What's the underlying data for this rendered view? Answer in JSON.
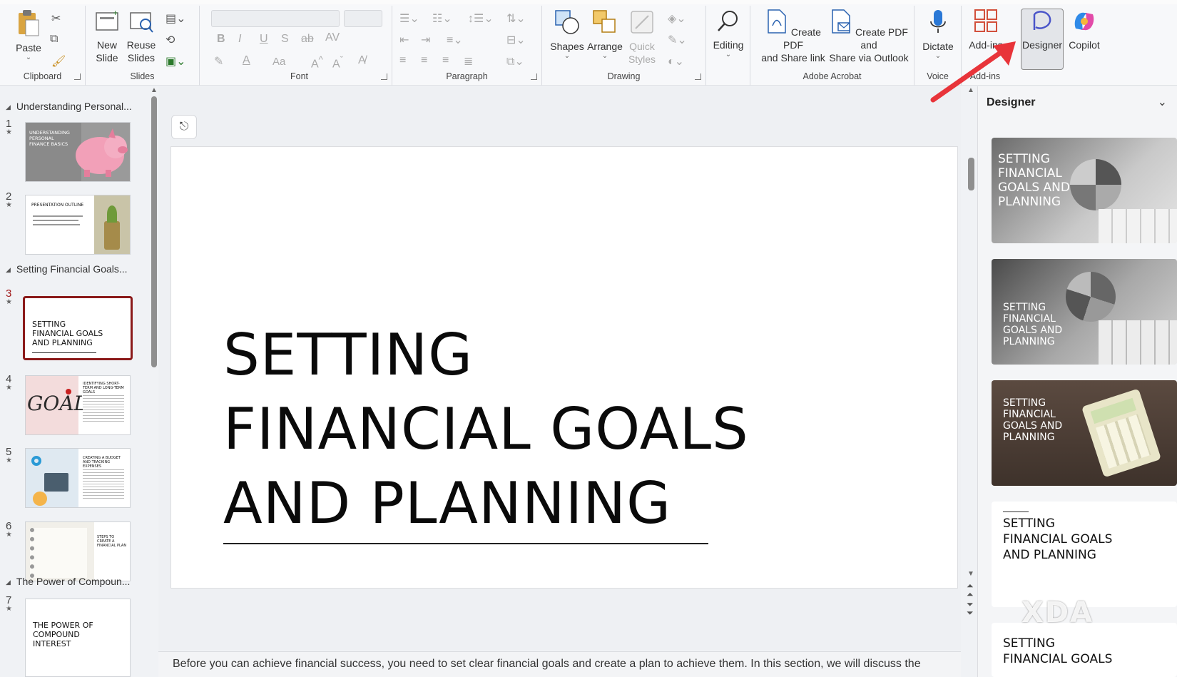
{
  "ribbon": {
    "groups": {
      "clipboard": "Clipboard",
      "slides": "Slides",
      "font": "Font",
      "paragraph": "Paragraph",
      "drawing": "Drawing",
      "adobe": "Adobe Acrobat",
      "voice": "Voice",
      "addins": "Add-ins"
    },
    "buttons": {
      "paste": "Paste",
      "new_slide_1": "New",
      "new_slide_2": "Slide",
      "reuse_1": "Reuse",
      "reuse_2": "Slides",
      "shapes": "Shapes",
      "arrange": "Arrange",
      "quick_styles_1": "Quick",
      "quick_styles_2": "Styles",
      "editing": "Editing",
      "create_pdf_1": "Create PDF",
      "create_pdf_2": "and Share link",
      "create_pdf_outlook_1": "Create PDF and",
      "create_pdf_outlook_2": "Share via Outlook",
      "dictate": "Dictate",
      "addins": "Add-ins",
      "designer": "Designer",
      "copilot": "Copilot"
    },
    "font_controls": {
      "bold": "B",
      "italic": "I",
      "underline": "U",
      "shadow": "S",
      "strike": "ab",
      "spacing": "AV",
      "case": "Aa"
    }
  },
  "slides_pane": {
    "sections": [
      "Understanding Personal...",
      "Setting Financial Goals...",
      "The Power of Compoun..."
    ],
    "thumbnails": [
      {
        "num": "1",
        "text": "UNDERSTANDING PERSONAL FINANCE BASICS"
      },
      {
        "num": "2",
        "text": "PRESENTATION OUTLINE"
      },
      {
        "num": "3",
        "text": "SETTING FINANCIAL GOALS AND PLANNING"
      },
      {
        "num": "4",
        "text": "IDENTIFYING SHORT-TERM AND LONG-TERM GOALS"
      },
      {
        "num": "5",
        "text": "CREATING A BUDGET AND TRACKING EXPENSES"
      },
      {
        "num": "6",
        "text": "STEPS TO CREATE A FINANCIAL PLAN"
      },
      {
        "num": "7",
        "text": "THE POWER OF COMPOUND INTEREST"
      }
    ],
    "goal_word": "GOAL"
  },
  "slide": {
    "title_line1": "SETTING",
    "title_line2": "FINANCIAL GOALS",
    "title_line3": "AND PLANNING"
  },
  "notes": {
    "text": "Before you can achieve financial success, you need to set clear financial goals and create a plan to achieve them. In this section, we will discuss the"
  },
  "designer": {
    "title": "Designer",
    "cards": [
      "SETTING\nFINANCIAL\nGOALS AND\nPLANNING",
      "SETTING\nFINANCIAL\nGOALS AND\nPLANNING",
      "SETTING\nFINANCIAL\nGOALS AND\nPLANNING",
      "SETTING\nFINANCIAL GOALS\nAND PLANNING",
      "SETTING\nFINANCIAL GOALS"
    ]
  },
  "watermark": "XDA",
  "colors": {
    "accent": "#8b1a1a",
    "arrow": "#e8343a",
    "ribbon_bg": "#f7f8fa"
  }
}
